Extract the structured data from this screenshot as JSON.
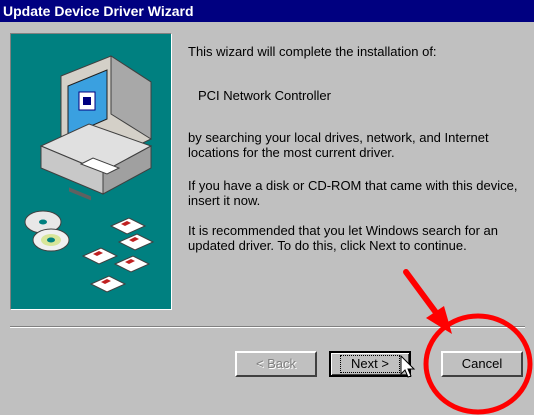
{
  "window": {
    "title": "Update Device Driver Wizard"
  },
  "body": {
    "intro": "This wizard will complete the installation of:",
    "device_name": "PCI Network Controller",
    "search_description": "by searching your local drives, network, and Internet locations for the most current driver.",
    "disk_instruction": "If you have a disk or CD-ROM that came with this device, insert it now.",
    "recommendation": "It is recommended that you let Windows search for an updated driver. To do this, click Next to continue."
  },
  "buttons": {
    "back_label": "< Back",
    "next_label": "Next >",
    "cancel_label": "Cancel",
    "back_enabled": false
  },
  "colors": {
    "titlebar": "#000080",
    "dialog_bg": "#c0c0c0",
    "illustration_bg": "#008080",
    "annotation": "#ff0000"
  },
  "icons": {
    "illustration": "computer-with-cds-and-floppy-disks",
    "annotation_arrow": "red-arrow-icon",
    "annotation_circle": "red-circle-highlight",
    "cursor": "mouse-pointer-icon"
  }
}
